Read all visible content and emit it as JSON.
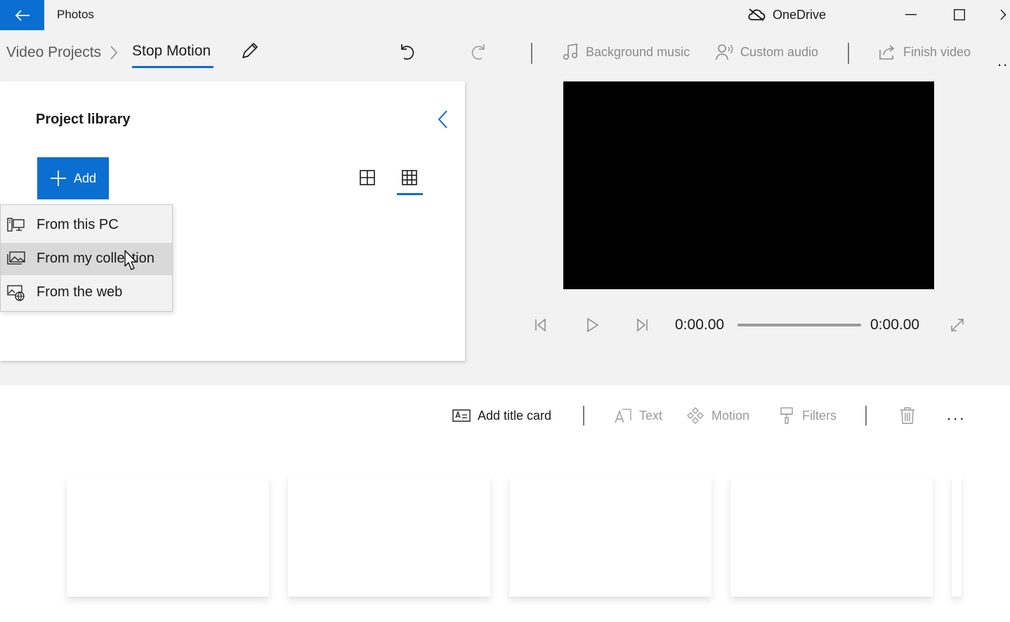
{
  "titlebar": {
    "app_name": "Photos",
    "onedrive_label": "OneDrive"
  },
  "breadcrumb": {
    "root": "Video Projects",
    "current": "Stop Motion"
  },
  "toolbar": {
    "background_music": "Background music",
    "custom_audio": "Custom audio",
    "finish_video": "Finish video",
    "more": "..."
  },
  "library": {
    "title": "Project library",
    "add_label": "Add",
    "menu": [
      {
        "label": "From this PC",
        "icon": "pc-icon"
      },
      {
        "label": "From my collection",
        "icon": "collection-icon"
      },
      {
        "label": "From the web",
        "icon": "web-icon"
      }
    ],
    "hovered_index": 1
  },
  "player": {
    "current_time": "0:00.00",
    "total_time": "0:00.00"
  },
  "storyboard": {
    "add_title_card": "Add title card",
    "text": "Text",
    "motion": "Motion",
    "filters": "Filters",
    "more": "..."
  },
  "colors": {
    "accent": "#0a6fd1",
    "background": "#f2f2f2"
  }
}
